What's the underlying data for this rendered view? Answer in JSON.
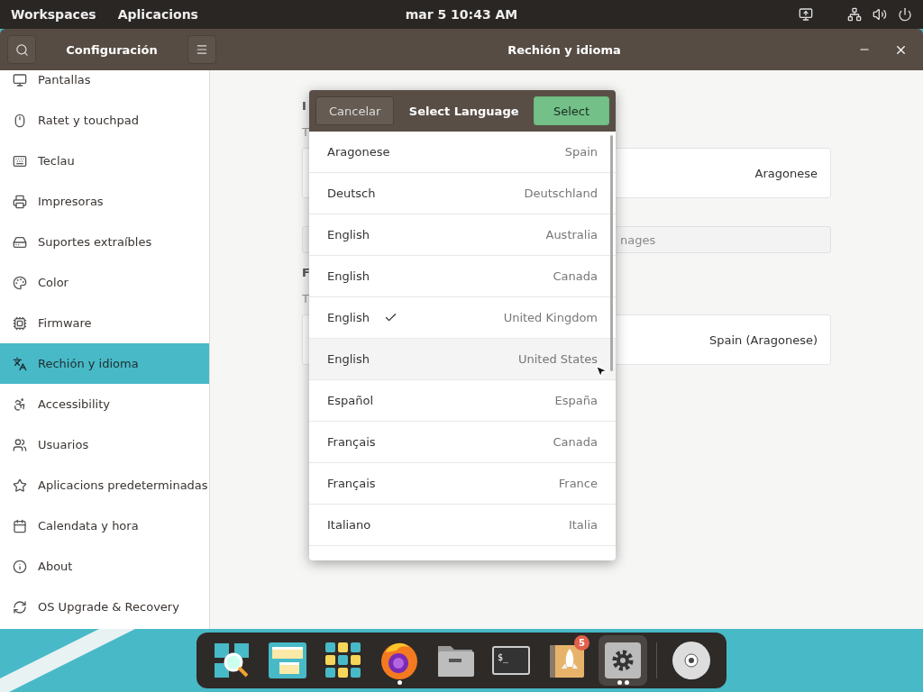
{
  "top_bar": {
    "items": [
      "Workspaces",
      "Aplicacions"
    ],
    "clock": "mar 5  10:43 AM",
    "tray": [
      {
        "kind": "display"
      },
      {
        "kind": "network"
      },
      {
        "kind": "volume"
      },
      {
        "kind": "power"
      }
    ]
  },
  "window": {
    "title": "Rechión y idioma",
    "sidebar_title": "Configuración"
  },
  "sidebar": {
    "items": [
      {
        "label": "Pantallas",
        "selected": false
      },
      {
        "label": "Ratet y touchpad",
        "selected": false
      },
      {
        "label": "Teclau",
        "selected": false
      },
      {
        "label": "Impresoras",
        "selected": false
      },
      {
        "label": "Suportes extraíbles",
        "selected": false
      },
      {
        "label": "Color",
        "selected": false
      },
      {
        "label": "Firmware",
        "selected": false
      },
      {
        "label": "Rechión y idioma",
        "selected": true
      },
      {
        "label": "Accessibility",
        "selected": false
      },
      {
        "label": "Usuarios",
        "selected": false
      },
      {
        "label": "Aplicacions predeterminadas",
        "selected": false
      },
      {
        "label": "Calendata y hora",
        "selected": false
      },
      {
        "label": "About",
        "selected": false
      },
      {
        "label": "OS Upgrade & Recovery",
        "selected": false
      }
    ]
  },
  "content": {
    "sections": [
      {
        "heading": "I",
        "description": "T",
        "value": "Aragonese",
        "search_placeholder": "nages"
      },
      {
        "heading": "F",
        "description": "T",
        "value": "Spain (Aragonese)"
      }
    ]
  },
  "dialog": {
    "title": "Select Language",
    "cancel": "Cancelar",
    "confirm": "Select",
    "rows": [
      {
        "language": "Aragonese",
        "region": "Spain",
        "checked": false,
        "hovered": false
      },
      {
        "language": "Deutsch",
        "region": "Deutschland",
        "checked": false,
        "hovered": false
      },
      {
        "language": "English",
        "region": "Australia",
        "checked": false,
        "hovered": false
      },
      {
        "language": "English",
        "region": "Canada",
        "checked": false,
        "hovered": false
      },
      {
        "language": "English",
        "region": "United Kingdom",
        "checked": true,
        "hovered": false
      },
      {
        "language": "English",
        "region": "United States",
        "checked": false,
        "hovered": true
      },
      {
        "language": "Español",
        "region": "España",
        "checked": false,
        "hovered": false
      },
      {
        "language": "Français",
        "region": "Canada",
        "checked": false,
        "hovered": false
      },
      {
        "language": "Français",
        "region": "France",
        "checked": false,
        "hovered": false
      },
      {
        "language": "Italiano",
        "region": "Italia",
        "checked": false,
        "hovered": false
      }
    ]
  },
  "dock": {
    "items": [
      {
        "kind": "search",
        "running": false,
        "active": false
      },
      {
        "kind": "workspaces",
        "running": false,
        "active": false
      },
      {
        "kind": "apps",
        "running": false,
        "active": false
      },
      {
        "kind": "browser",
        "running": true,
        "active": false
      },
      {
        "kind": "files",
        "running": false,
        "active": false
      },
      {
        "kind": "terminal",
        "prompt": "$_",
        "running": false,
        "active": false
      },
      {
        "kind": "launcher",
        "badge": "5",
        "running": false,
        "active": false
      },
      {
        "kind": "settings",
        "running": true,
        "active": true
      },
      {
        "kind": "disc",
        "running": false,
        "active": false
      }
    ]
  }
}
